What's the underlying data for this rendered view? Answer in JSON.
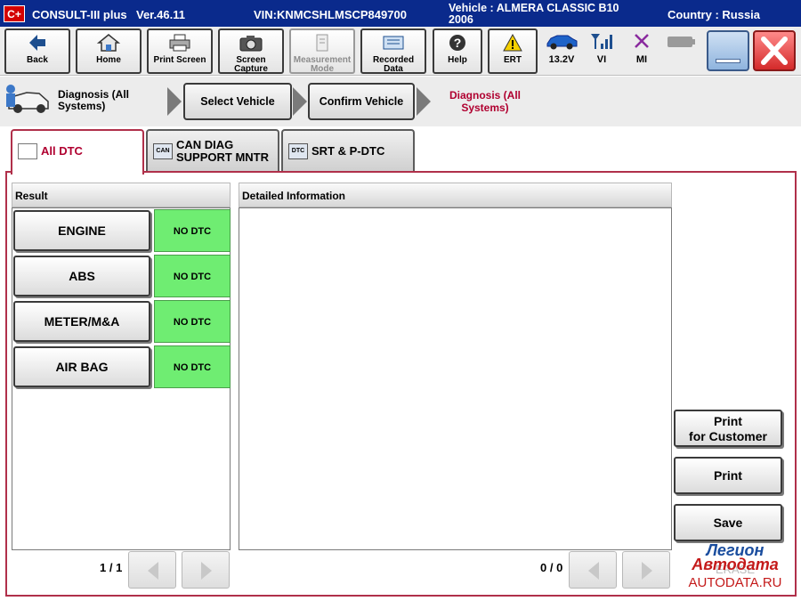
{
  "titlebar": {
    "logo": "C+",
    "app": "CONSULT-III plus",
    "version": "Ver.46.11",
    "vin": "VIN:KNMCSHLMSCP849700",
    "vehicle": "Vehicle : ALMERA CLASSIC B10 2006",
    "country": "Country : Russia"
  },
  "toolbar": {
    "back": "Back",
    "home": "Home",
    "print_screen": "Print Screen",
    "screen_capture_1": "Screen",
    "screen_capture_2": "Capture",
    "measurement_1": "Measurement",
    "measurement_2": "Mode",
    "recorded_1": "Recorded",
    "recorded_2": "Data",
    "help": "Help",
    "ert": "ERT",
    "battery": "13.2V",
    "vi": "VI",
    "mi": "MI"
  },
  "breadcrumb": {
    "current_label": "Diagnosis (All Systems)",
    "step1": "Select Vehicle",
    "step2": "Confirm Vehicle",
    "active": "Diagnosis (All Systems)"
  },
  "tabs": [
    {
      "label": "All DTC"
    },
    {
      "label_1": "CAN DIAG",
      "label_2": "SUPPORT MNTR",
      "icon_text": "CAN"
    },
    {
      "label": "SRT & P-DTC",
      "icon_text": "DTC"
    }
  ],
  "result": {
    "header": "Result",
    "rows": [
      {
        "system": "ENGINE",
        "status": "NO DTC"
      },
      {
        "system": "ABS",
        "status": "NO DTC"
      },
      {
        "system": "METER/M&A",
        "status": "NO DTC"
      },
      {
        "system": "AIR BAG",
        "status": "NO DTC"
      }
    ],
    "page": "1 / 1"
  },
  "detail": {
    "header": "Detailed Information",
    "page": "0 / 0"
  },
  "actions": {
    "print_customer_1": "Print",
    "print_customer_2": "for Customer",
    "print": "Print",
    "save": "Save",
    "erase": "ERASE"
  },
  "watermark": {
    "line1": "Легион",
    "line2": "Автодата",
    "line3": "AUTODATA.RU"
  },
  "colors": {
    "titlebar": "#0a2a8c",
    "accent": "#b0304a",
    "no_dtc": "#6fed72",
    "close": "#e03a3a"
  },
  "icons": {
    "back": "back-arrow-icon",
    "home": "home-icon",
    "print_screen": "printer-icon",
    "screen_capture": "camera-icon",
    "measurement": "measurement-icon",
    "recorded": "recorded-data-icon",
    "help": "help-icon",
    "ert": "warning-icon",
    "battery": "car-icon",
    "vi": "signal-icon",
    "mi": "cross-icon",
    "battery_level": "battery-icon"
  }
}
